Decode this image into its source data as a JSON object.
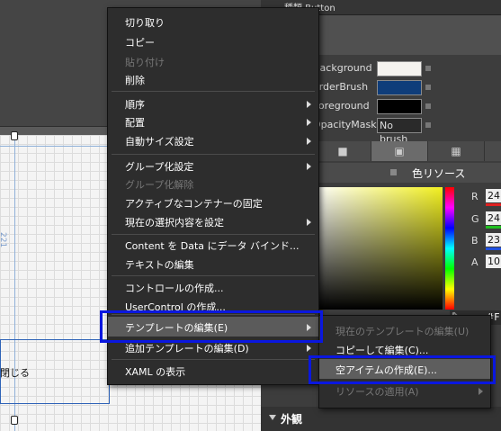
{
  "properties_header": {
    "title": "種類  Button"
  },
  "brushes": [
    {
      "label": "Background",
      "color": "#f4f2ee"
    },
    {
      "label": "orderBrush",
      "color": "#0f3d7a"
    },
    {
      "label": "Foreground",
      "color": "#000000"
    },
    {
      "label": "OpacityMask",
      "value": "No brush"
    }
  ],
  "color_panel": {
    "title": "色リソース",
    "channels": [
      {
        "label": "R",
        "value": "24",
        "bar_color": "#e02020"
      },
      {
        "label": "G",
        "value": "24",
        "bar_color": "#20c020"
      },
      {
        "label": "B",
        "value": "23",
        "bar_color": "#2050e0"
      },
      {
        "label": "A",
        "value": "10"
      }
    ],
    "hex_value": "#F"
  },
  "appearance": {
    "title": "外観"
  },
  "artboard": {
    "dimension_label": "221",
    "button_text": "閉じる"
  },
  "context_menu": {
    "items": [
      {
        "label": "切り取り",
        "disabled": false,
        "submenu": false
      },
      {
        "label": "コピー",
        "disabled": false,
        "submenu": false
      },
      {
        "label": "貼り付け",
        "disabled": true,
        "submenu": false
      },
      {
        "label": "削除",
        "disabled": false,
        "submenu": false,
        "sep_after": true
      },
      {
        "label": "順序",
        "disabled": false,
        "submenu": true
      },
      {
        "label": "配置",
        "disabled": false,
        "submenu": true
      },
      {
        "label": "自動サイズ設定",
        "disabled": false,
        "submenu": true,
        "sep_after": true
      },
      {
        "label": "グループ化設定",
        "disabled": false,
        "submenu": true
      },
      {
        "label": "グループ化解除",
        "disabled": true,
        "submenu": false
      },
      {
        "label": "アクティブなコンテナーの固定",
        "disabled": false,
        "submenu": false
      },
      {
        "label": "現在の選択内容を設定",
        "disabled": false,
        "submenu": true,
        "sep_after": true
      },
      {
        "label": "Content を Data にデータ バインド...",
        "disabled": false,
        "submenu": false
      },
      {
        "label": "テキストの編集",
        "disabled": false,
        "submenu": false,
        "sep_after": true
      },
      {
        "label": "コントロールの作成...",
        "disabled": false,
        "submenu": false
      },
      {
        "label": "UserControl の作成...",
        "disabled": false,
        "submenu": false,
        "sep_after": true
      },
      {
        "label": "テンプレートの編集(E)",
        "disabled": false,
        "submenu": true,
        "highlighted": true
      },
      {
        "label": "追加テンプレートの編集(D)",
        "disabled": false,
        "submenu": true,
        "sep_after": true
      },
      {
        "label": "XAML の表示",
        "disabled": false,
        "submenu": false
      }
    ]
  },
  "template_submenu": {
    "items": [
      {
        "label": "現在のテンプレートの編集(U)",
        "disabled": true
      },
      {
        "label": "コピーして編集(C)...",
        "disabled": false
      },
      {
        "label": "空アイテムの作成(E)...",
        "disabled": false,
        "highlighted": true
      },
      {
        "label": "リソースの適用(A)",
        "disabled": true,
        "submenu": true
      }
    ]
  }
}
